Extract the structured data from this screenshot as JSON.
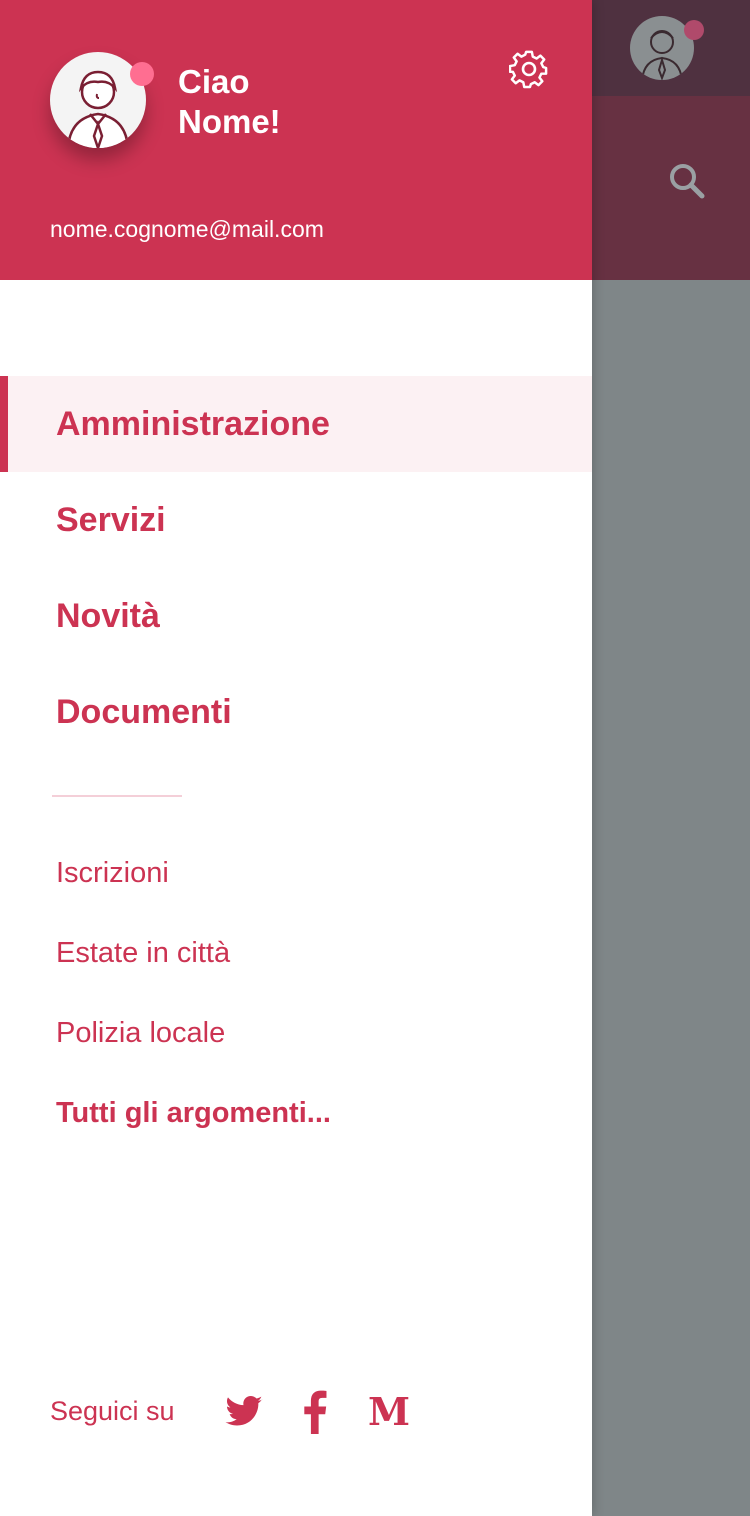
{
  "header": {
    "greeting_line1": "Ciao",
    "greeting_line2": "Nome!",
    "email": "nome.cognome@mail.com"
  },
  "nav": {
    "primary": [
      {
        "label": "Amministrazione",
        "active": true
      },
      {
        "label": "Servizi",
        "active": false
      },
      {
        "label": "Novità",
        "active": false
      },
      {
        "label": "Documenti",
        "active": false
      }
    ],
    "secondary": [
      {
        "label": "Iscrizioni",
        "bold": false
      },
      {
        "label": "Estate in città",
        "bold": false
      },
      {
        "label": "Polizia locale",
        "bold": false
      },
      {
        "label": "Tutti gli argomenti...",
        "bold": true
      }
    ]
  },
  "footer": {
    "follow_label": "Seguici su",
    "social": [
      "twitter-icon",
      "facebook-icon",
      "medium-icon"
    ],
    "medium_glyph": "M"
  },
  "icons": {
    "settings": "gear-icon",
    "search": "search-icon",
    "avatar": "user-avatar-icon"
  },
  "colors": {
    "brand": "#cc3352",
    "notification_dot": "#ff6e91",
    "active_bg": "#fcf1f3",
    "overlay": "#7f8688"
  }
}
